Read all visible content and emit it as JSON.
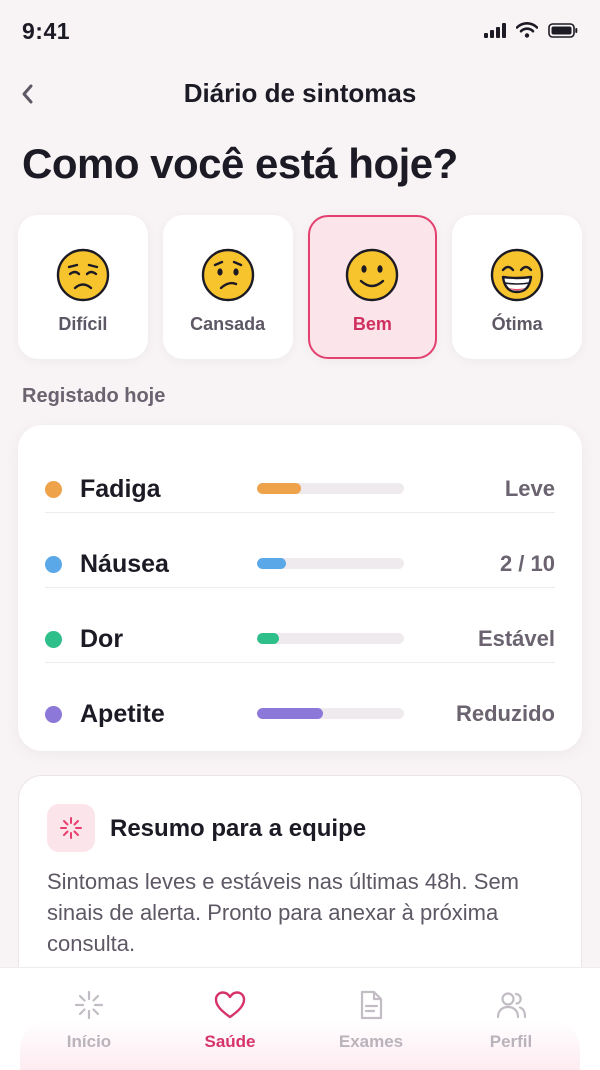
{
  "status_bar": {
    "time": "9:41"
  },
  "header": {
    "title": "Diário de sintomas",
    "back_icon": "chevron-left-icon"
  },
  "headline": "Como você está hoje?",
  "moods": [
    {
      "label": "Difícil",
      "icon": "weary-face-icon",
      "selected": false
    },
    {
      "label": "Cansada",
      "icon": "confused-face-icon",
      "selected": false
    },
    {
      "label": "Bem",
      "icon": "smiling-face-icon",
      "selected": true
    },
    {
      "label": "Ótima",
      "icon": "grinning-face-icon",
      "selected": false
    }
  ],
  "section_label": "Registado hoje",
  "symptoms": [
    {
      "name": "Fadiga",
      "value": "Leve",
      "level": 0.3,
      "color": "#eea24a"
    },
    {
      "name": "Náusea",
      "value": "2 / 10",
      "level": 0.2,
      "color": "#5aa8e8"
    },
    {
      "name": "Dor",
      "value": "Estável",
      "level": 0.15,
      "color": "#2ebf8a"
    },
    {
      "name": "Apetite",
      "value": "Reduzido",
      "level": 0.45,
      "color": "#8c78d8"
    }
  ],
  "summary": {
    "title": "Resumo para a equipe",
    "text": "Sintomas leves e estáveis nas últimas 48h. Sem sinais de alerta. Pronto para anexar à próxima consulta.",
    "icon": "sparkle-icon"
  },
  "tabs": [
    {
      "label": "Início",
      "icon": "home-burst-icon",
      "active": false
    },
    {
      "label": "Saúde",
      "icon": "heart-icon",
      "active": true
    },
    {
      "label": "Exames",
      "icon": "document-icon",
      "active": false
    },
    {
      "label": "Perfil",
      "icon": "people-icon",
      "active": false
    }
  ],
  "colors": {
    "accent": "#d6336a",
    "selected_bg": "#fbe4ea",
    "emoji_yellow": "#f7c42e"
  }
}
